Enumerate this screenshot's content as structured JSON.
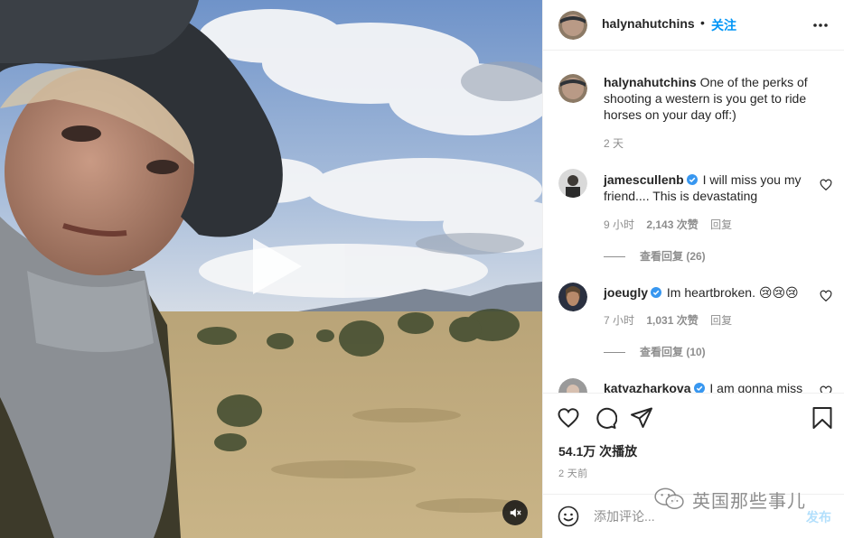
{
  "post": {
    "author": "halynahutchins",
    "follow_label": "关注",
    "separator": "•"
  },
  "caption": {
    "username": "halynahutchins",
    "text": "One of the perks of shooting a western is you get to ride horses on your day off:)",
    "time": "2 天"
  },
  "comments": [
    {
      "username": "jamescullenb",
      "verified": true,
      "text": "I will miss you my friend.... This is devastating",
      "time": "9 小时",
      "likes": "2,143 次赞",
      "reply_label": "回复",
      "view_replies": "查看回复 (26)"
    },
    {
      "username": "joeugly",
      "verified": true,
      "text": "Im heartbroken. 😢😢😢",
      "time": "7 小时",
      "likes": "1,031 次赞",
      "reply_label": "回复",
      "view_replies": "查看回复 (10)"
    },
    {
      "username": "katyazharkova",
      "verified": true,
      "text": "I am gonna miss"
    }
  ],
  "stats": {
    "views": "54.1万 次播放",
    "posted": "2 天前"
  },
  "composer": {
    "placeholder": "添加评论...",
    "post_label": "发布"
  },
  "watermark": {
    "text": "英国那些事儿"
  },
  "icons": {
    "more": "more-horizontal-icon",
    "like": "heart-icon",
    "comment": "comment-bubble-icon",
    "share": "paper-plane-icon",
    "save": "bookmark-icon",
    "emoji": "smiley-icon",
    "play": "play-icon",
    "mute": "speaker-muted-icon",
    "verified": "verified-badge-icon"
  },
  "colors": {
    "accent": "#0095f6",
    "verified": "#3897f0",
    "muted_text": "#8e8e8e",
    "post_disabled": "#b2dffc"
  }
}
